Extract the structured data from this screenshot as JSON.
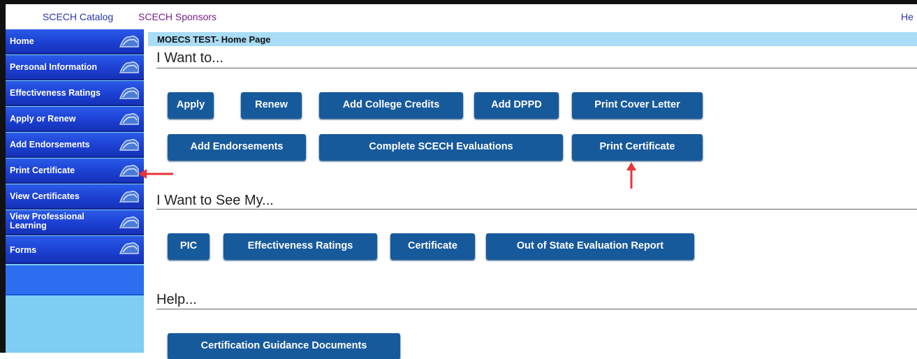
{
  "topnav": {
    "catalog": "SCECH Catalog",
    "sponsors": "SCECH Sponsors",
    "help": "He"
  },
  "sidebar": {
    "items": [
      {
        "label": "Home"
      },
      {
        "label": "Personal Information"
      },
      {
        "label": "Effectiveness Ratings"
      },
      {
        "label": "Apply or Renew"
      },
      {
        "label": "Add Endorsements"
      },
      {
        "label": "Print Certificate"
      },
      {
        "label": "View Certificates"
      },
      {
        "label_line1": "View Professional",
        "label_line2": "Learning"
      },
      {
        "label": "Forms"
      }
    ]
  },
  "main": {
    "breadcrumb": "MOECS TEST- Home Page",
    "want_to": {
      "title": "I Want to...",
      "row1": [
        "Apply",
        "Renew",
        "Add College Credits",
        "Add DPPD",
        "Print Cover Letter"
      ],
      "row2": [
        "Add Endorsements",
        "Complete SCECH Evaluations",
        "Print Certificate"
      ]
    },
    "see_my": {
      "title": "I Want to See My...",
      "buttons": [
        "PIC",
        "Effectiveness Ratings",
        "Certificate",
        "Out of State Evaluation Report"
      ]
    },
    "help": {
      "title": "Help...",
      "buttons": [
        "Certification Guidance Documents"
      ]
    }
  },
  "colors": {
    "button": "#175a9c",
    "sidebar_item": "#1c40d2",
    "sidebar_bg": "#7ecdf2",
    "breadcrumb_bg": "#a9dcf6",
    "annotation_arrow": "#e8343a"
  }
}
